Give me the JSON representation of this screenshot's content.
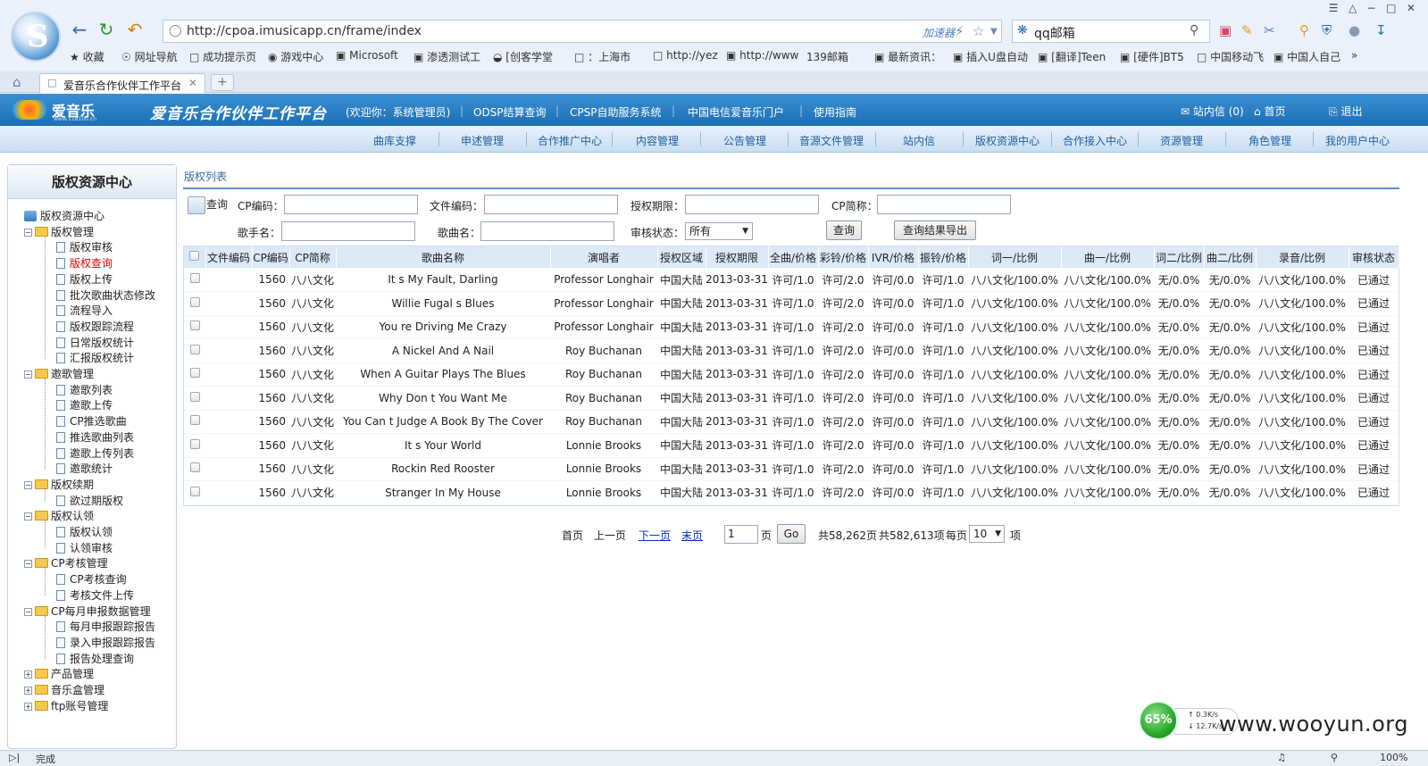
{
  "browser": {
    "url": "http://cpoa.imusicapp.cn/frame/index",
    "accelerator": "加速器",
    "search_text": "qq邮箱",
    "tab_title": "爱音乐合作伙伴工作平台",
    "bookmarks": [
      "收藏",
      "网址导航",
      "成功提示页",
      "游戏中心",
      "Microsoft",
      "渗透测试工",
      "[创客学堂",
      "：上海市",
      "http://yez",
      "http://www",
      "139邮箱",
      "最新资讯：",
      "插入U盘自动",
      "[翻译]Teen",
      "[硬件]BT5",
      "中国移动飞",
      "中国人自己"
    ]
  },
  "app": {
    "logo_text": "爱音乐",
    "logo_sub": "www.118100.cn",
    "title": "爱音乐合作伙伴工作平台",
    "top_links": [
      "(欢迎你：系统管理员)",
      "ODSP结算查询",
      "CPSP自助服务系统",
      "中国电信爱音乐门户",
      "使用指南"
    ],
    "inbox": "站内信 (0)",
    "home": "首页",
    "logout": "退出",
    "menu": [
      "曲库支撑",
      "申述管理",
      "合作推广中心",
      "内容管理",
      "公告管理",
      "音源文件管理",
      "站内信",
      "版权资源中心",
      "合作接入中心",
      "资源管理",
      "角色管理",
      "我的用户中心"
    ]
  },
  "sidebar": {
    "title": "版权资源中心",
    "root": "版权资源中心",
    "groups": [
      {
        "label": "版权管理",
        "expanded": true,
        "items": [
          "版权审核",
          "版权查询",
          "版权上传",
          "批次歌曲状态修改",
          "流程导入",
          "版权跟踪流程",
          "日常版权统计",
          "汇报版权统计"
        ]
      },
      {
        "label": "邀歌管理",
        "expanded": true,
        "items": [
          "邀歌列表",
          "邀歌上传",
          "CP推选歌曲",
          "推选歌曲列表",
          "邀歌上传列表",
          "邀歌统计"
        ]
      },
      {
        "label": "版权续期",
        "expanded": true,
        "items": [
          "欲过期版权"
        ]
      },
      {
        "label": "版权认领",
        "expanded": true,
        "items": [
          "版权认领",
          "认领审核"
        ]
      },
      {
        "label": "CP考核管理",
        "expanded": true,
        "items": [
          "CP考核查询",
          "考核文件上传"
        ]
      },
      {
        "label": "CP每月申报数据管理",
        "expanded": true,
        "items": [
          "每月申报跟踪报告",
          "录入申报跟踪报告",
          "报告处理查询"
        ]
      },
      {
        "label": "产品管理",
        "expanded": false,
        "items": []
      },
      {
        "label": "音乐盒管理",
        "expanded": false,
        "items": []
      },
      {
        "label": "ftp账号管理",
        "expanded": false,
        "items": []
      }
    ],
    "active_item": "版权查询"
  },
  "main": {
    "breadcrumb": "版权列表",
    "query": {
      "query_label": "查询",
      "cp_code_label": "CP编码：",
      "file_code_label": "文件编码：",
      "auth_term_label": "授权期限：",
      "cp_name_label": "CP简称：",
      "singer_label": "歌手名：",
      "song_label": "歌曲名：",
      "review_label": "审核状态：",
      "review_value": "所有",
      "search_button": "查询",
      "export_button": "查询结果导出"
    },
    "table": {
      "headers": [
        "文件编码",
        "CP编码",
        "CP简称",
        "歌曲名称",
        "演唱者",
        "授权区域",
        "授权期限",
        "全曲/价格",
        "彩铃/价格",
        "IVR/价格",
        "振铃/价格",
        "词一/比例",
        "曲一/比例",
        "词二/比例",
        "曲二/比例",
        "录音/比例",
        "审核状态"
      ],
      "rows": [
        [
          "",
          "1560",
          "八八文化",
          "It s My Fault, Darling",
          "Professor Longhair",
          "中国大陆",
          "2013-03-31",
          "许可/1.0",
          "许可/2.0",
          "许可/0.0",
          "许可/1.0",
          "八八文化/100.0%",
          "八八文化/100.0%",
          "无/0.0%",
          "无/0.0%",
          "八八文化/100.0%",
          "已通过"
        ],
        [
          "",
          "1560",
          "八八文化",
          "Willie Fugal s Blues",
          "Professor Longhair",
          "中国大陆",
          "2013-03-31",
          "许可/1.0",
          "许可/2.0",
          "许可/0.0",
          "许可/1.0",
          "八八文化/100.0%",
          "八八文化/100.0%",
          "无/0.0%",
          "无/0.0%",
          "八八文化/100.0%",
          "已通过"
        ],
        [
          "",
          "1560",
          "八八文化",
          "You re Driving Me Crazy",
          "Professor Longhair",
          "中国大陆",
          "2013-03-31",
          "许可/1.0",
          "许可/2.0",
          "许可/0.0",
          "许可/1.0",
          "八八文化/100.0%",
          "八八文化/100.0%",
          "无/0.0%",
          "无/0.0%",
          "八八文化/100.0%",
          "已通过"
        ],
        [
          "",
          "1560",
          "八八文化",
          "A Nickel And A Nail",
          "Roy Buchanan",
          "中国大陆",
          "2013-03-31",
          "许可/1.0",
          "许可/2.0",
          "许可/0.0",
          "许可/1.0",
          "八八文化/100.0%",
          "八八文化/100.0%",
          "无/0.0%",
          "无/0.0%",
          "八八文化/100.0%",
          "已通过"
        ],
        [
          "",
          "1560",
          "八八文化",
          "When A Guitar Plays The Blues",
          "Roy Buchanan",
          "中国大陆",
          "2013-03-31",
          "许可/1.0",
          "许可/2.0",
          "许可/0.0",
          "许可/1.0",
          "八八文化/100.0%",
          "八八文化/100.0%",
          "无/0.0%",
          "无/0.0%",
          "八八文化/100.0%",
          "已通过"
        ],
        [
          "",
          "1560",
          "八八文化",
          "Why Don t You Want Me",
          "Roy Buchanan",
          "中国大陆",
          "2013-03-31",
          "许可/1.0",
          "许可/2.0",
          "许可/0.0",
          "许可/1.0",
          "八八文化/100.0%",
          "八八文化/100.0%",
          "无/0.0%",
          "无/0.0%",
          "八八文化/100.0%",
          "已通过"
        ],
        [
          "",
          "1560",
          "八八文化",
          "You Can t Judge A Book By The Cover",
          "Roy Buchanan",
          "中国大陆",
          "2013-03-31",
          "许可/1.0",
          "许可/2.0",
          "许可/0.0",
          "许可/1.0",
          "八八文化/100.0%",
          "八八文化/100.0%",
          "无/0.0%",
          "无/0.0%",
          "八八文化/100.0%",
          "已通过"
        ],
        [
          "",
          "1560",
          "八八文化",
          "It s Your World",
          "Lonnie Brooks",
          "中国大陆",
          "2013-03-31",
          "许可/1.0",
          "许可/2.0",
          "许可/0.0",
          "许可/1.0",
          "八八文化/100.0%",
          "八八文化/100.0%",
          "无/0.0%",
          "无/0.0%",
          "八八文化/100.0%",
          "已通过"
        ],
        [
          "",
          "1560",
          "八八文化",
          "Rockin Red Rooster",
          "Lonnie Brooks",
          "中国大陆",
          "2013-03-31",
          "许可/1.0",
          "许可/2.0",
          "许可/0.0",
          "许可/1.0",
          "八八文化/100.0%",
          "八八文化/100.0%",
          "无/0.0%",
          "无/0.0%",
          "八八文化/100.0%",
          "已通过"
        ],
        [
          "",
          "1560",
          "八八文化",
          "Stranger In My House",
          "Lonnie Brooks",
          "中国大陆",
          "2013-03-31",
          "许可/1.0",
          "许可/2.0",
          "许可/0.0",
          "许可/1.0",
          "八八文化/100.0%",
          "八八文化/100.0%",
          "无/0.0%",
          "无/0.0%",
          "八八文化/100.0%",
          "已通过"
        ]
      ]
    },
    "pager": {
      "first": "首页",
      "prev": "上一页",
      "next": "下一页",
      "last": "末页",
      "page_value": "1",
      "page_unit": "页",
      "go": "Go",
      "total_pages": "共58,262页",
      "total_items": "共582,613项",
      "per_page_label": "每页",
      "per_page_value": "10",
      "per_page_unit": "项"
    }
  },
  "status": {
    "text": "完成",
    "zoom": "100%",
    "net_percent": "65%",
    "net_up": "0.3K/s",
    "net_down": "12.7K/s",
    "watermark": "www.wooyun.org"
  }
}
